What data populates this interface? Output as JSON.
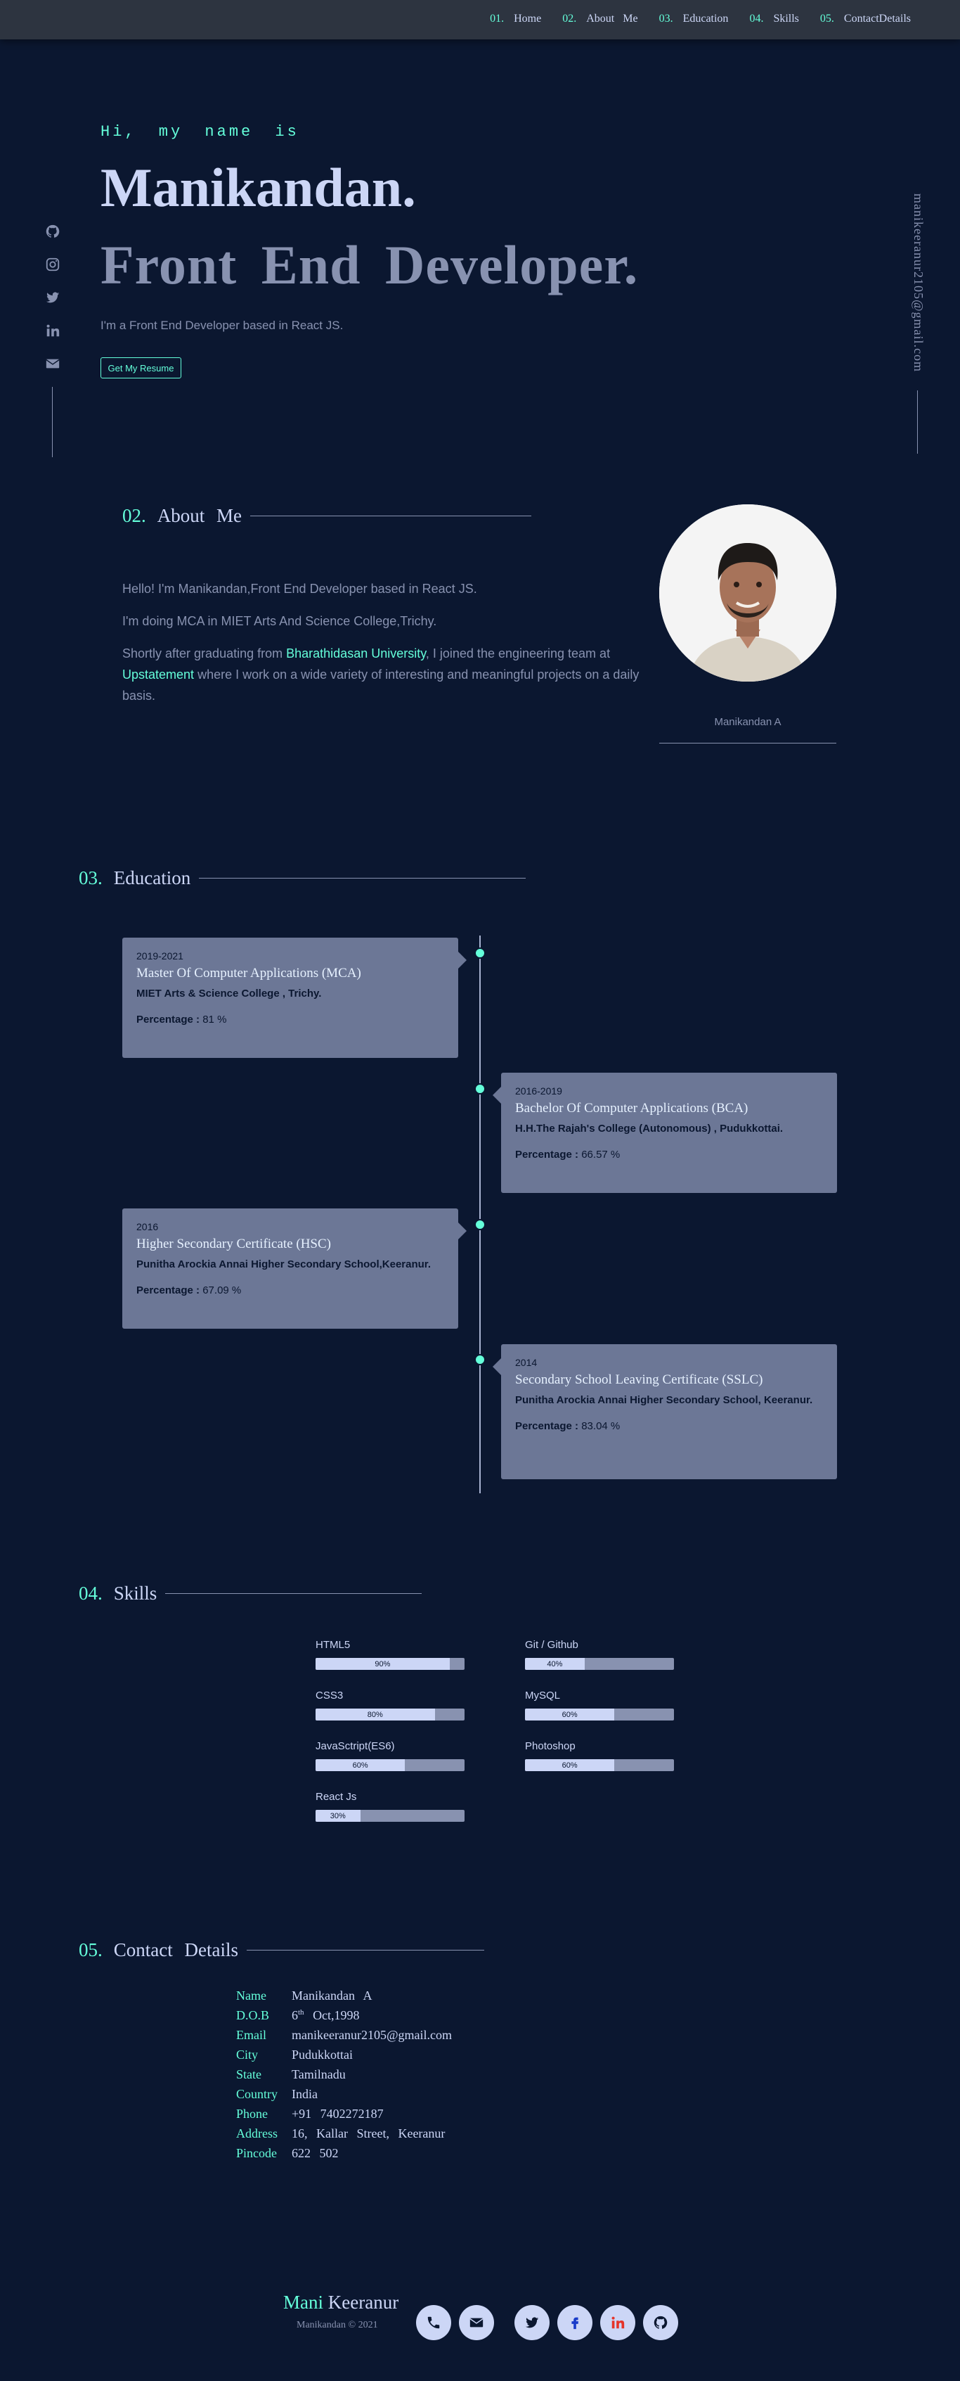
{
  "nav": {
    "items": [
      {
        "num": "01.",
        "label": "Home"
      },
      {
        "num": "02.",
        "label": "About Me"
      },
      {
        "num": "03.",
        "label": "Education"
      },
      {
        "num": "04.",
        "label": "Skills"
      },
      {
        "num": "05.",
        "label": "ContactDetails"
      }
    ]
  },
  "social_left": [
    "github-icon",
    "instagram-icon",
    "twitter-icon",
    "linkedin-icon",
    "mail-icon"
  ],
  "email_vertical": "manikeeranur2105@gmail.com",
  "hero": {
    "greeting": "Hi, my name is",
    "name": "Manikandan.",
    "role": "Front End Developer.",
    "description": "I'm a Front End Developer based in React JS.",
    "resume_button": "Get My Resume"
  },
  "about": {
    "num": "02.",
    "title": "About Me",
    "p1": "Hello! I'm Manikandan,Front End Developer based in React JS.",
    "p2": "I'm doing MCA in MIET Arts And Science College,Trichy.",
    "p3_before": "Shortly after graduating from ",
    "p3_link1": "Bharathidasan University",
    "p3_middle": ", I joined the engineering team at ",
    "p3_link2": "Upstatement",
    "p3_after": " where I work on a wide variety of interesting and meaningful projects on a daily basis.",
    "avatar_caption": "Manikandan A"
  },
  "education": {
    "num": "03.",
    "title": "Education",
    "items": [
      {
        "year": "2019-2021",
        "degree": "Master Of Computer Applications (MCA)",
        "school": "MIET Arts & Science College , Trichy.",
        "pct_label": "Percentage :",
        "pct_value": "81 %"
      },
      {
        "year": "2016-2019",
        "degree": "Bachelor Of Computer Applications (BCA)",
        "school": "H.H.The Rajah's College (Autonomous) , Pudukkottai.",
        "pct_label": "Percentage :",
        "pct_value": "66.57 %"
      },
      {
        "year": "2016",
        "degree": "Higher Secondary Certificate (HSC)",
        "school": "Punitha Arockia Annai Higher Secondary School,Keeranur.",
        "pct_label": "Percentage :",
        "pct_value": "67.09 %"
      },
      {
        "year": "2014",
        "degree": "Secondary School Leaving Certificate (SSLC)",
        "school": "Punitha Arockia Annai Higher Secondary School, Keeranur.",
        "pct_label": "Percentage :",
        "pct_value": "83.04 %"
      }
    ]
  },
  "skills": {
    "num": "04.",
    "title": "Skills",
    "items": [
      {
        "name": "HTML5",
        "level": 90,
        "label": "90%"
      },
      {
        "name": "Git / Github",
        "level": 40,
        "label": "40%"
      },
      {
        "name": "CSS3",
        "level": 80,
        "label": "80%"
      },
      {
        "name": "MySQL",
        "level": 60,
        "label": "60%"
      },
      {
        "name": "JavaSctript(ES6)",
        "level": 60,
        "label": "60%"
      },
      {
        "name": "Photoshop",
        "level": 60,
        "label": "60%"
      },
      {
        "name": "React Js",
        "level": 30,
        "label": "30%"
      }
    ]
  },
  "contact": {
    "num": "05.",
    "title": "Contact Details",
    "rows": [
      {
        "key": "Name",
        "value": "Manikandan A"
      },
      {
        "key": "D.O.B",
        "value_pre": "6",
        "value_sup": "th",
        "value_post": " Oct,1998"
      },
      {
        "key": "Email",
        "value": "manikeeranur2105@gmail.com"
      },
      {
        "key": "City",
        "value": "Pudukkottai"
      },
      {
        "key": "State",
        "value": "Tamilnadu"
      },
      {
        "key": "Country",
        "value": "India"
      },
      {
        "key": "Phone",
        "value": "+91 7402272187"
      },
      {
        "key": "Address",
        "value": "16, Kallar Street, Keeranur"
      },
      {
        "key": "Pincode",
        "value": "622 502"
      }
    ]
  },
  "footer": {
    "brand_first": "Mani",
    "brand_last": " Keeranur",
    "copyright": "Manikandan © 2021",
    "icons": [
      "phone-icon",
      "mail-icon",
      "twitter-icon",
      "facebook-icon",
      "linkedin-icon",
      "github-icon"
    ]
  },
  "colors": {
    "background": "#0b1730",
    "accent": "#64ffda",
    "card": "#6c7796",
    "text_light": "#ccd6f6",
    "text_muted": "#8892b0",
    "linkedin_red": "#e5342a",
    "facebook_blue": "#1a3cc9"
  }
}
